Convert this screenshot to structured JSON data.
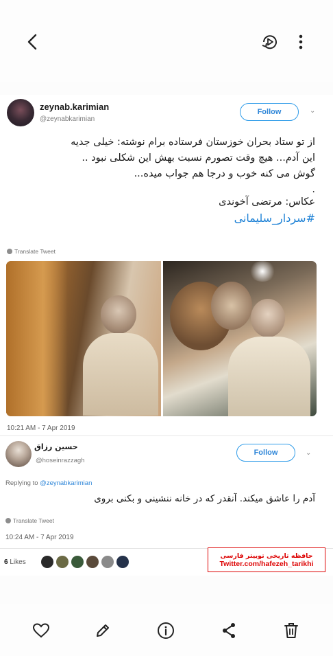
{
  "toolbar": {
    "back_icon": "chevron-left-icon",
    "rotate_icon": "rotate-icon",
    "more_icon": "more-vertical-icon"
  },
  "tweet": {
    "author_name": "zeynab.karimian",
    "author_handle": "@zeynabkarimian",
    "follow_label": "Follow",
    "lines": [
      "از تو ستاد بحران خوزستان فرستاده برام نوشته: خیلی جدیه",
      "این آدم... هیچ وقت تصورم نسبت بهش این شکلی نبود ..",
      "گوش می کنه خوب و درجا هم جواب میده...",
      ".",
      "عکاس: مرتضی آخوندی"
    ],
    "hashtag": "#سردار_سلیمانی",
    "translate_label": "Translate Tweet",
    "timestamp": "10:21 AM - 7 Apr 2019"
  },
  "reply": {
    "author_name": "حسین رزاق",
    "author_handle": "@hoseinrazzagh",
    "follow_label": "Follow",
    "replying_prefix": "Replying to",
    "replying_mention": "@zeynabkarimian",
    "text": "آدم را عاشق میکند. آنقدر که در خانه ننشینی و بکنی بروی",
    "translate_label": "Translate Tweet",
    "timestamp": "10:24 AM - 7 Apr 2019",
    "likes_count": "6",
    "likes_label": "Likes"
  },
  "watermark": {
    "line1": "حافظه تاریخی توییتر فارسی",
    "line2": "Twitter.com/hafezeh_tarikhi"
  },
  "bottom_bar": {
    "icons": [
      "heart-icon",
      "edit-icon",
      "info-icon",
      "share-icon",
      "trash-icon"
    ]
  },
  "colors": {
    "accent": "#2e86d8",
    "watermark_red": "#dd0000"
  }
}
